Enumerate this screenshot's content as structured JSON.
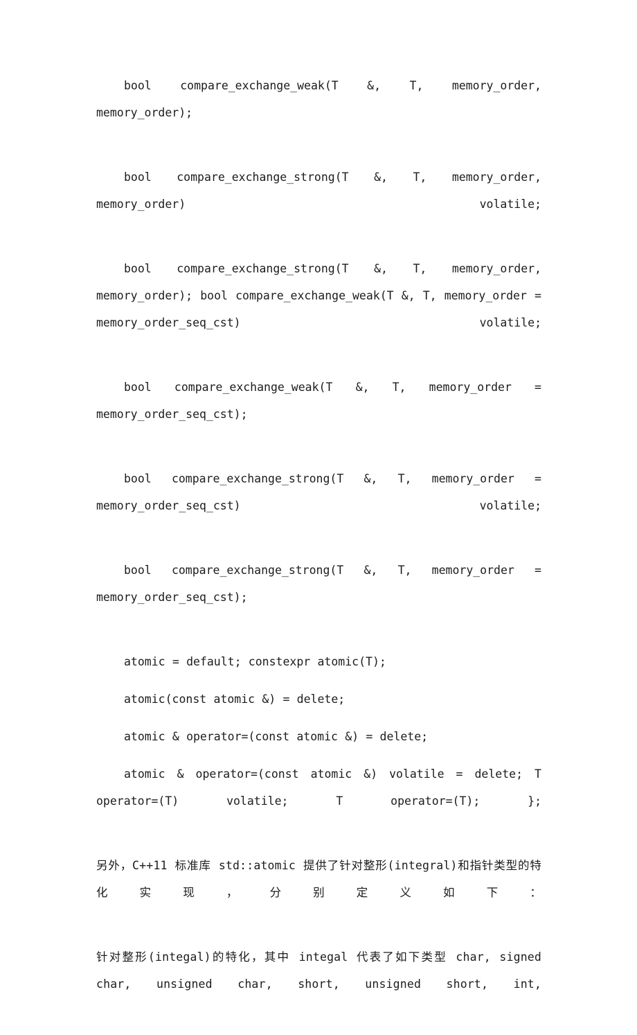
{
  "document": {
    "language": "zh-CN",
    "background_color": "#ffffff",
    "text_color": "#1c1c1c",
    "paragraphs": [
      {
        "id": "p1",
        "kind": "code",
        "text": "bool   compare_exchange_weak(T   &,    T,    memory_order, memory_order);"
      },
      {
        "id": "p2",
        "kind": "code",
        "text": "bool   compare_exchange_strong(T   &,    T,    memory_order, memory_order) volatile;"
      },
      {
        "id": "p3",
        "kind": "code",
        "text": "bool   compare_exchange_strong(T   &,    T,    memory_order, memory_order);            bool   compare_exchange_weak(T  &,   T,  memory_order = memory_order_seq_cst) volatile;"
      },
      {
        "id": "p4",
        "kind": "code",
        "text": "bool   compare_exchange_weak(T   &,    T,    memory_order   = memory_order_seq_cst);"
      },
      {
        "id": "p5",
        "kind": "code",
        "text": "bool   compare_exchange_strong(T   &,    T,   memory_order   = memory_order_seq_cst) volatile;"
      },
      {
        "id": "p6",
        "kind": "code",
        "text": "bool  compare_exchange_strong(T   &,   T,   memory_order   = memory_order_seq_cst);"
      },
      {
        "id": "p7",
        "kind": "code",
        "text": "atomic = default;      constexpr atomic(T);"
      },
      {
        "id": "p8",
        "kind": "code",
        "text": "atomic(const atomic &) = delete;"
      },
      {
        "id": "p9",
        "kind": "code",
        "text": "atomic & operator=(const atomic &) = delete;"
      },
      {
        "id": "p10",
        "kind": "code",
        "text": "atomic & operator=(const atomic &) volatile = delete;     T operator=(T) volatile;     T operator=(T); };"
      },
      {
        "id": "p11",
        "kind": "prose",
        "text": "另外，C++11 标准库 std::atomic 提供了针对整形(integral)和指针类型的特化实现，分别定义如下："
      },
      {
        "id": "p12",
        "kind": "prose",
        "text": "针对整形(integal)的特化，其中 integal 代表了如下类型 char, signed char, unsigned char, short, unsigned short, int,"
      }
    ]
  }
}
